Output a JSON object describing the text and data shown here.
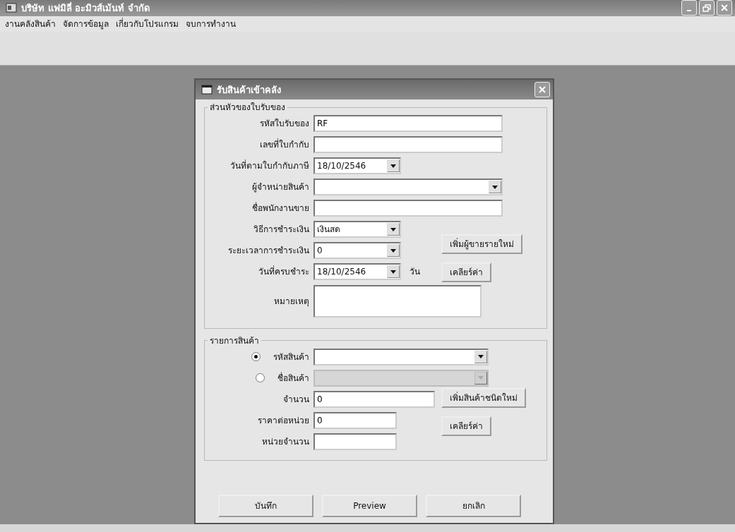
{
  "window": {
    "title": "บริษัท แฟมิลี่ อะมิวส์เม้นท์ จำกัด"
  },
  "menu": [
    "งานคลังสินค้า",
    "จัดการข้อมูล",
    "เกี่ยวกับโปรแกรม",
    "จบการทำงาน"
  ],
  "dialog": {
    "title": "รับสินค้าเข้าคลัง",
    "header_group": {
      "title": "ส่วนหัวของใบรับของ",
      "fields": [
        {
          "label": "รหัสใบรับของ",
          "kind": "text",
          "value": "RF"
        },
        {
          "label": "เลขที่ใบกำกับ",
          "kind": "text"
        },
        {
          "label": "วันที่ตามใบกำกับภาษี",
          "kind": "combo",
          "value": "18/10/2546"
        },
        {
          "label": "ผู้จำหน่ายสินค้า",
          "kind": "combo"
        },
        {
          "label": "ชื่อพนักงานขาย",
          "kind": "text"
        },
        {
          "label": "วิธีการชำระเงิน",
          "kind": "combo",
          "value": "เงินสด"
        },
        {
          "label": "ระยะเวลาการชำระเงิน",
          "kind": "combo",
          "value": "0"
        },
        {
          "label": "วันที่ครบชำระ",
          "kind": "combo",
          "value": "18/10/2546",
          "suffix": "วัน"
        },
        {
          "label": "หมายเหตุ",
          "kind": "textarea"
        }
      ],
      "buttons": [
        "เพิ่มผู้ขายรายใหม่",
        "เคลียร์ค่า"
      ]
    },
    "items_group": {
      "title": "รายการสินค้า",
      "fields": [
        {
          "label": "รหัสสินค้า",
          "kind": "radio_combo",
          "selected": true,
          "disabled": false
        },
        {
          "label": "ชื่อสินค้า",
          "kind": "radio_combo",
          "selected": false,
          "disabled": true
        },
        {
          "label": "จำนวน",
          "kind": "text",
          "value": "0"
        },
        {
          "label": "ราคาต่อหน่วย",
          "kind": "text",
          "value": "0"
        },
        {
          "label": "หน่วยจำนวน",
          "kind": "text"
        }
      ],
      "buttons": [
        "เพิ่มสินค้าชนิดใหม่",
        "เคลียร์ค่า"
      ]
    },
    "buttons": [
      "บันทึก",
      "Preview",
      "ยกเลิก"
    ]
  }
}
